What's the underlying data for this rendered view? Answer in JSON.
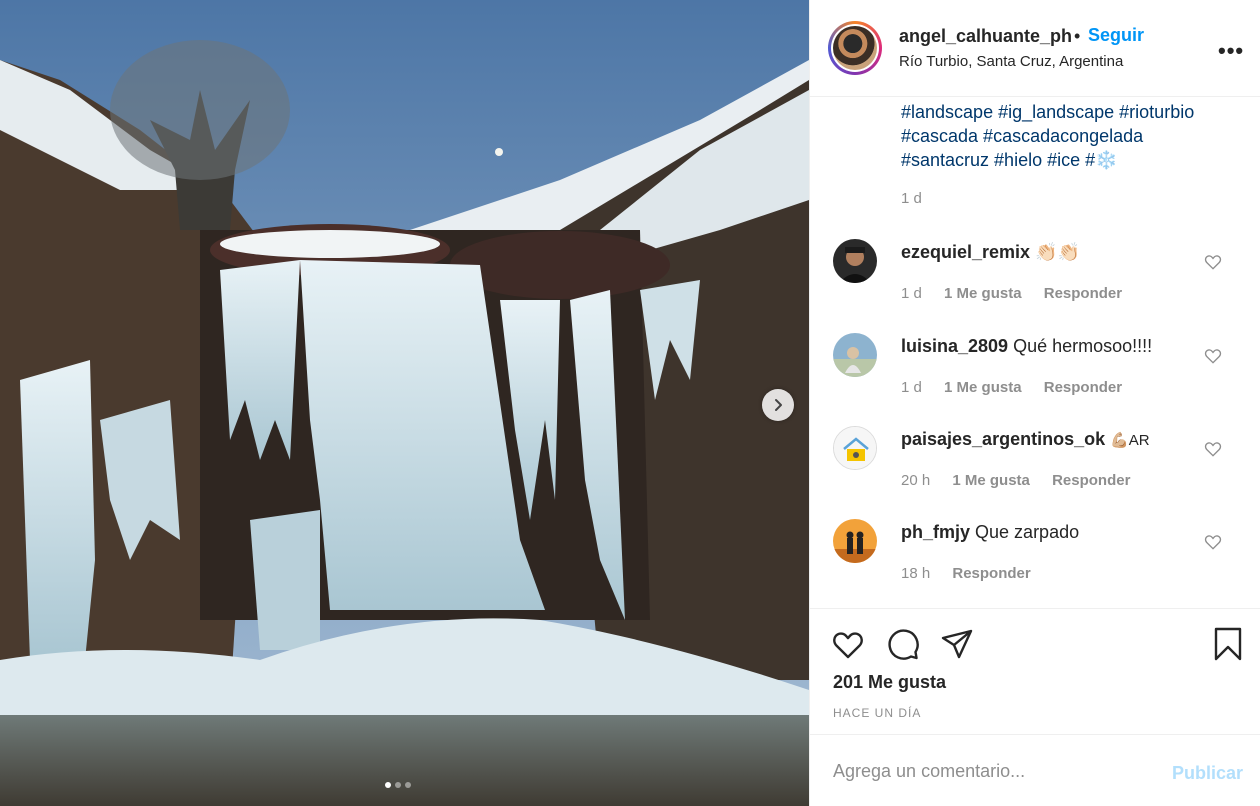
{
  "post": {
    "username": "angel_calhuante_ph",
    "bullet": "•",
    "follow_label": "Seguir",
    "location": "Río Turbio, Santa Cruz, Argentina",
    "more_label": "•••",
    "carousel": {
      "slide_count": 3,
      "active_index": 0
    }
  },
  "caption": {
    "line1": "#landscape #ig_landscape #rioturbio",
    "line2": "#cascada #cascadacongelada",
    "line3": "#santacruz #hielo #ice #❄️",
    "time": "1 d"
  },
  "comments": [
    {
      "user": "ezequiel_remix",
      "text": "👏🏻👏🏻",
      "time": "1 d",
      "likes": "1 Me gusta",
      "reply": "Responder"
    },
    {
      "user": "luisina_2809",
      "text": "Qué hermosoo!!!!",
      "time": "1 d",
      "likes": "1 Me gusta",
      "reply": "Responder"
    },
    {
      "user": "paisajes_argentinos_ok",
      "text": "💪🏼AR",
      "time": "20 h",
      "likes": "1 Me gusta",
      "reply": "Responder"
    },
    {
      "user": "ph_fmjy",
      "text": "Que zarpado",
      "time": "18 h",
      "likes": "",
      "reply": "Responder"
    }
  ],
  "actions": {
    "likes_count": "201 Me gusta",
    "time_ago": "HACE UN DÍA"
  },
  "add_comment": {
    "placeholder": "Agrega un comentario...",
    "publish_label": "Publicar"
  },
  "colors": {
    "link_blue": "#0095f6",
    "hashtag_blue": "#00376b",
    "muted": "#8e8e8e",
    "publish_disabled": "#b2dffc"
  }
}
